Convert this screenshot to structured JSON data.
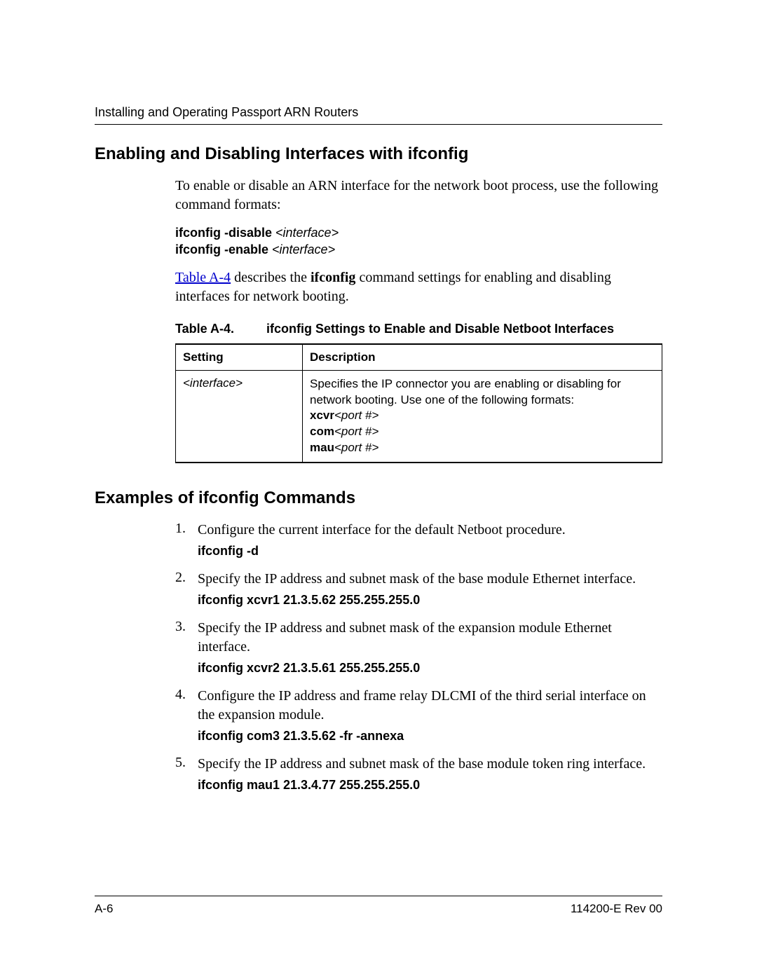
{
  "header": {
    "running": "Installing and Operating Passport ARN Routers"
  },
  "section1": {
    "title": "Enabling and Disabling Interfaces with ifconfig",
    "intro": "To enable or disable an ARN interface for the network boot process, use the following command formats:",
    "cmd1_bold": "ifconfig -disable ",
    "cmd1_ital": "<interface>",
    "cmd2_bold": "ifconfig -enable ",
    "cmd2_ital": "<interface>",
    "xref_text": "Table A-4",
    "after_xref_1": " describes the ",
    "after_xref_bold": "ifconfig",
    "after_xref_2": " command settings for enabling and disabling interfaces for network booting."
  },
  "table": {
    "label": "Table A-4.",
    "caption": "ifconfig Settings to Enable and Disable Netboot Interfaces",
    "head_setting": "Setting",
    "head_desc": "Description",
    "row_setting": "<interface>",
    "desc_line1": "Specifies the IP connector you are enabling or disabling for network booting. Use one of the following formats:",
    "fmt1_b": "xcvr",
    "fmt1_i": "<port #>",
    "fmt2_b": "com",
    "fmt2_i": "<port #>",
    "fmt3_b": "mau",
    "fmt3_i": "<port #>"
  },
  "section2": {
    "title": "Examples of ifconfig Commands",
    "items": [
      {
        "n": "1.",
        "text": "Configure the current interface for the default Netboot procedure.",
        "cmd": "ifconfig -d"
      },
      {
        "n": "2.",
        "text": "Specify the IP address and subnet mask of the base module Ethernet interface.",
        "cmd": "ifconfig xcvr1 21.3.5.62 255.255.255.0"
      },
      {
        "n": "3.",
        "text": "Specify the IP address and subnet mask of the expansion module Ethernet interface.",
        "cmd": "ifconfig xcvr2 21.3.5.61 255.255.255.0"
      },
      {
        "n": "4.",
        "text": "Configure the IP address and frame relay DLCMI of the third serial interface on the expansion module.",
        "cmd": "ifconfig com3 21.3.5.62 -fr -annexa"
      },
      {
        "n": "5.",
        "text": "Specify the IP address and subnet mask of the base module token ring interface.",
        "cmd": "ifconfig mau1 21.3.4.77 255.255.255.0"
      }
    ]
  },
  "footer": {
    "page": "A-6",
    "docid": "114200-E Rev 00"
  }
}
